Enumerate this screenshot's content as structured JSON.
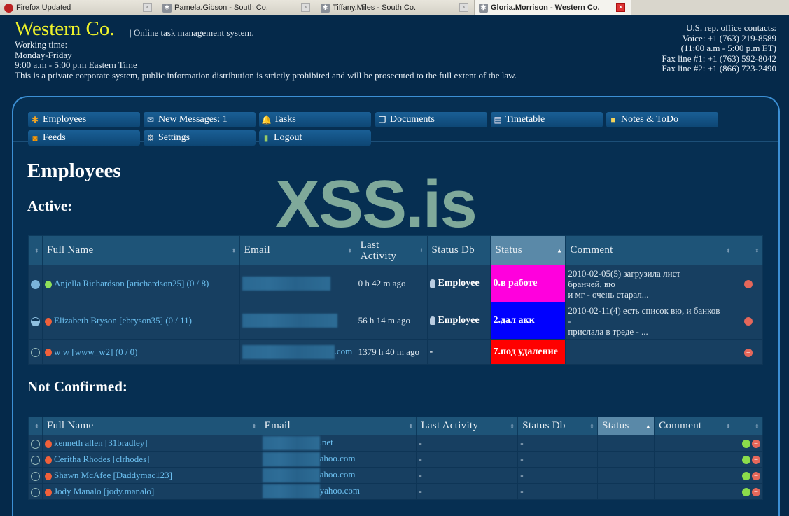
{
  "browser_tabs": [
    {
      "title": "Firefox Updated",
      "active": false
    },
    {
      "title": "Pamela.Gibson - South Co.",
      "active": false
    },
    {
      "title": "Tiffany.Miles - South Co.",
      "active": false
    },
    {
      "title": "Gloria.Morrison - Western Co.",
      "active": true
    }
  ],
  "header": {
    "brand": "Western Co.",
    "tagline": "| Online task management system.",
    "info": [
      "Working time:",
      "Monday-Friday",
      "9:00 a.m - 5:00 p.m Eastern Time",
      "This is a private corporate system, public information distribution is strictly prohibited and will be prosecuted to the full extent of the law."
    ],
    "contacts": [
      "U.S. rep. office contacts:",
      "Voice: +1 (763) 219-8589",
      "(11:00 a.m - 5:00 p.m ET)",
      "Fax line #1: +1 (763) 592-8042",
      "Fax line #2: +1 (866) 723-2490"
    ]
  },
  "nav": [
    {
      "label": "Employees",
      "icon": "asterisk-icon"
    },
    {
      "label": "New Messages: 1",
      "icon": "envelope-icon"
    },
    {
      "label": "Tasks",
      "icon": "bell-icon"
    },
    {
      "label": "Documents",
      "icon": "documents-icon"
    },
    {
      "label": "Timetable",
      "icon": "calendar-icon"
    },
    {
      "label": "Notes & ToDo",
      "icon": "note-icon"
    },
    {
      "label": "Feeds",
      "icon": "rss-icon"
    },
    {
      "label": "Settings",
      "icon": "gear-icon"
    },
    {
      "label": "Logout",
      "icon": "exit-icon"
    }
  ],
  "page_title": "Employees",
  "watermark": "XSS.is",
  "active": {
    "heading": "Active:",
    "columns": [
      "Full Name",
      "Email",
      "Last Activity",
      "Status Db",
      "Status",
      "Comment"
    ],
    "rows": [
      {
        "name": "Anjella Richardson [arichardson25] (0 / 8)",
        "email_suffix": "",
        "last": "0 h 42 m ago",
        "statusdb": "Employee",
        "status": "0.в работе",
        "status_color": "#ff00dd",
        "comment": [
          "2010-02-05(5) загрузила лист",
          "бранчей, вю",
          "и мг - очень старал..."
        ]
      },
      {
        "name": "Elizabeth Bryson [ebryson35] (0 / 11)",
        "email_suffix": "",
        "last": "56 h 14 m ago",
        "statusdb": "Employee",
        "status": "2.дал акк",
        "status_color": "#0000ff",
        "comment": [
          "2010-02-11(4) есть список вю, и банков",
          "-",
          "прислала в треде - ..."
        ]
      },
      {
        "name": "w w [www_w2] (0 / 0)",
        "email_suffix": ".com",
        "last": "1379 h 40 m ago",
        "statusdb": "-",
        "status": "7.под удаление",
        "status_color": "#ff0000",
        "comment": [
          "",
          "",
          ""
        ]
      }
    ]
  },
  "not_confirmed": {
    "heading": "Not Confirmed:",
    "columns": [
      "Full Name",
      "Email",
      "Last Activity",
      "Status Db",
      "Status",
      "Comment"
    ],
    "rows": [
      {
        "name": "kenneth allen [31bradley]",
        "email_suffix": ".net",
        "last": "-",
        "statusdb": "-"
      },
      {
        "name": "Ceritha Rhodes [clrhodes]",
        "email_suffix": "ahoo.com",
        "last": "-",
        "statusdb": "-"
      },
      {
        "name": "Shawn McAfee [Daddymac123]",
        "email_suffix": "ahoo.com",
        "last": "-",
        "statusdb": "-"
      },
      {
        "name": "Jody Manalo [jody.manalo]",
        "email_suffix": "yahoo.com",
        "last": "-",
        "statusdb": "-"
      }
    ]
  }
}
